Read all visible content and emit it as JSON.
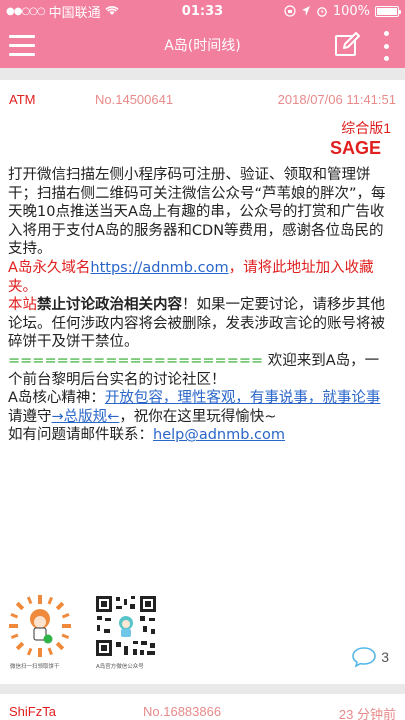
{
  "status_bar": {
    "carrier": "中国联通",
    "time": "01:33",
    "battery": "100%",
    "battery_level": 1.0
  },
  "nav": {
    "title": "A岛(时间线)"
  },
  "post": {
    "user_id": "ATM",
    "post_no": "No.14500641",
    "time": "2018/07/06 11:41:51",
    "board": "综合版1",
    "sage": "SAGE",
    "para1": "打开微信扫描左侧小程序码可注册、验证、领取和管理饼干；扫描右侧二维码可关注微信公众号“芦苇娘的胖次”，每天晚10点推送当天A岛上有趣的串，公众号的打赏和广告收入将用于支付A岛的服务器和CDN等费用，感谢各位岛民的支持。",
    "domain_pre": "A岛永久域名",
    "domain_link": "https://adnmb.com",
    "domain_post": "，请将此地址加入收藏夹。",
    "rule_a": "本站",
    "rule_b": "禁止讨论政治相关内容",
    "rule_c": "！如果一定要讨论，请移步其他论坛。任何涉政内容将会被删除，发表涉政言论的账号将被碎饼干及饼干禁位。",
    "welcome_eq": "=====================",
    "welcome_rest": " 欢迎来到A岛，一个前台黎明后台实名的讨论社区！",
    "spirit_label": "A岛核心精神：",
    "spirit_link": "开放包容，理性客观，有事说事，就事论事",
    "follow_pre": "请遵守",
    "follow_link": "→总版规←",
    "follow_post": "，祝你在这里玩得愉快~",
    "contact_pre": "如有问题请邮件联系：",
    "contact_link": "help@adnmb.com",
    "qr_caption_left": "微信扫一扫领取饼干",
    "qr_caption_right": "A岛官方微信公众号",
    "reply_count": "3"
  },
  "next_post": {
    "user_id": "ShiFzTa",
    "post_no": "No.16883866",
    "time": "23 分钟前"
  },
  "colors": {
    "accent": "#f37f9f",
    "red": "#e02020",
    "meta_pink": "#e88a8a",
    "link": "#2a66c9",
    "green": "#2eaa2e"
  }
}
